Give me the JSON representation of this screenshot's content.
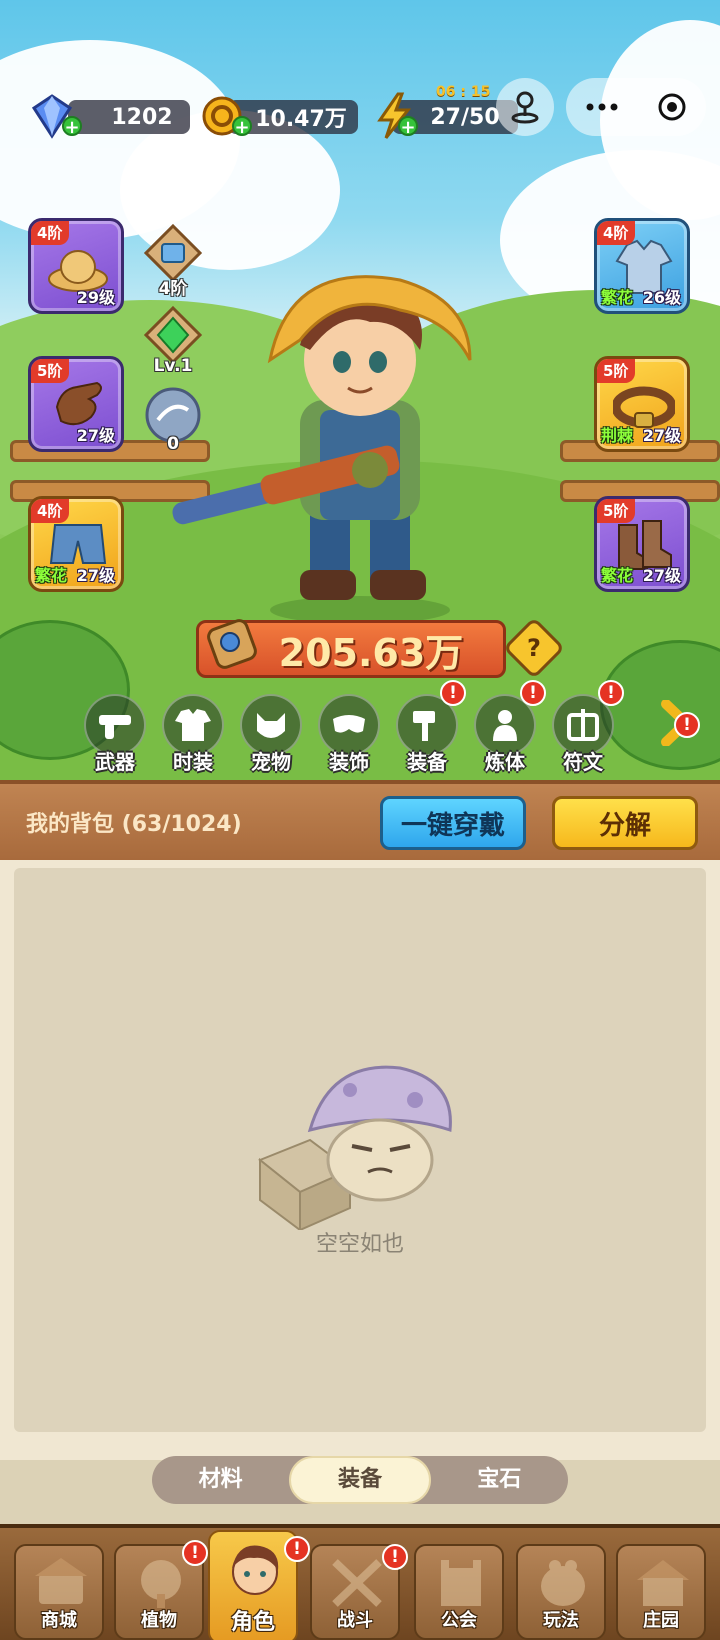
{
  "resources": {
    "diamonds": "1202",
    "gold": "10.47万",
    "energy": "27/50",
    "energy_timer": "06 : 15"
  },
  "equipment_left": [
    {
      "tier": "4阶",
      "level": "29级",
      "affix": "",
      "item": "straw-hat",
      "rarity": "purple"
    },
    {
      "tier": "5阶",
      "level": "27级",
      "affix": "",
      "item": "gloves",
      "rarity": "purple"
    },
    {
      "tier": "4阶",
      "level": "27级",
      "affix": "繁花",
      "item": "shorts",
      "rarity": "gold"
    }
  ],
  "equipment_right": [
    {
      "tier": "4阶",
      "level": "26级",
      "affix": "繁花",
      "item": "jacket",
      "rarity": "blue"
    },
    {
      "tier": "5阶",
      "level": "27级",
      "affix": "荆棘",
      "item": "belt",
      "rarity": "gold"
    },
    {
      "tier": "5阶",
      "level": "27级",
      "affix": "繁花",
      "item": "boots",
      "rarity": "purple"
    }
  ],
  "side_stats": {
    "map_badge": "4阶",
    "gem_level": "Lv.1",
    "orb_count": "0"
  },
  "power": "205.63万",
  "help_symbol": "?",
  "categories": [
    {
      "label": "武器",
      "icon": "gun-icon",
      "alert": false
    },
    {
      "label": "时装",
      "icon": "shirt-icon",
      "alert": false
    },
    {
      "label": "宠物",
      "icon": "cat-icon",
      "alert": false
    },
    {
      "label": "装饰",
      "icon": "mask-icon",
      "alert": false
    },
    {
      "label": "装备",
      "icon": "hammer-icon",
      "alert": true
    },
    {
      "label": "炼体",
      "icon": "body-icon",
      "alert": true
    },
    {
      "label": "符文",
      "icon": "rune-icon",
      "alert": true
    }
  ],
  "bag": {
    "title": "我的背包 (63/1024)",
    "equip_all": "一键穿戴",
    "decompose": "分解",
    "empty_text": "空空如也"
  },
  "tabs": [
    "材料",
    "装备",
    "宝石"
  ],
  "active_tab": "装备",
  "nav": [
    {
      "label": "商城",
      "alert": false
    },
    {
      "label": "植物",
      "alert": true
    },
    {
      "label": "角色",
      "alert": true
    },
    {
      "label": "战斗",
      "alert": true
    },
    {
      "label": "公会",
      "alert": false
    },
    {
      "label": "玩法",
      "alert": false
    },
    {
      "label": "庄园",
      "alert": false
    }
  ],
  "alert_symbol": "!",
  "plus_symbol": "+",
  "colors": {
    "accent_orange": "#e85a2a",
    "alert_red": "#e53323",
    "button_blue": "#2fa6ec",
    "button_yellow": "#f6b81c"
  }
}
